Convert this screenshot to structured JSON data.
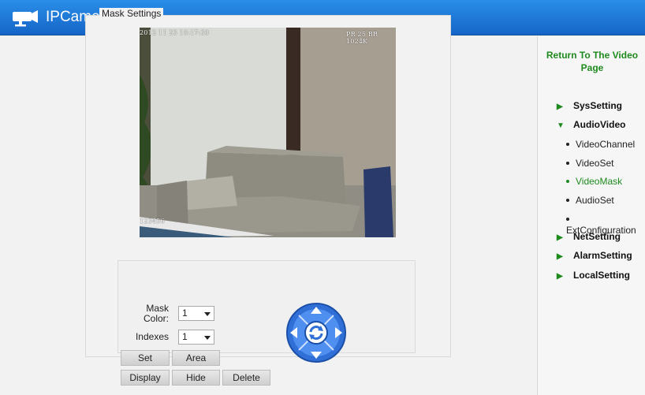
{
  "header": {
    "title": "IPCamera",
    "logo_icon": "camera-logo-icon"
  },
  "mask": {
    "legend": "Mask Settings",
    "osd_datetime": "2012 11 23 10:17:30",
    "osd_info": "PR 25 BR 1024K",
    "osd_label": "123456",
    "mask_color_label": "Mask Color:",
    "mask_color_value": "1",
    "indexes_label": "Indexes",
    "indexes_value": "1",
    "buttons": {
      "set": "Set",
      "area": "Area",
      "display": "Display",
      "hide": "Hide",
      "delete": "Delete"
    }
  },
  "sidebar": {
    "return_link": "Return To The Video Page",
    "menu": {
      "sys": "SysSetting",
      "audiovideo": "AudioVideo",
      "net": "NetSetting",
      "alarm": "AlarmSetting",
      "local": "LocalSetting"
    },
    "sub": {
      "videochannel": "VideoChannel",
      "videoset": "VideoSet",
      "videomask": "VideoMask",
      "audioset": "AudioSet",
      "extconfig": "ExtConfiguration"
    }
  },
  "colors": {
    "header": "#1a78d8",
    "accent_green": "#1e8a1e",
    "ptz_blue": "#2f6fd6"
  }
}
